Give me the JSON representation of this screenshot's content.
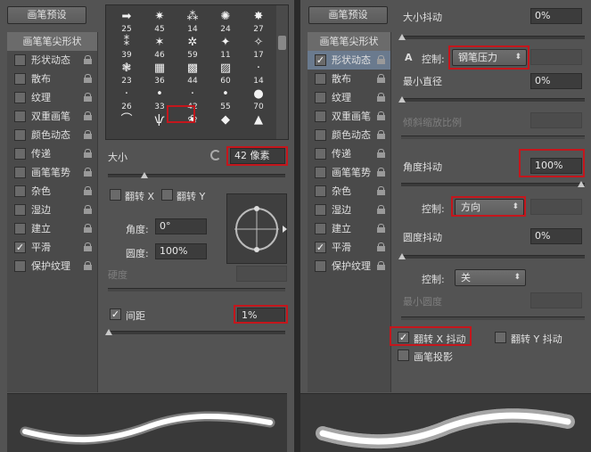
{
  "left": {
    "preset_button": "画笔预设",
    "list": [
      {
        "label": "画笔笔尖形状",
        "checked": false,
        "type": "head"
      },
      {
        "label": "形状动态",
        "checked": false,
        "lock": true
      },
      {
        "label": "散布",
        "checked": false,
        "lock": true
      },
      {
        "label": "纹理",
        "checked": false,
        "lock": true
      },
      {
        "label": "双重画笔",
        "checked": false,
        "lock": true
      },
      {
        "label": "颜色动态",
        "checked": false,
        "lock": true
      },
      {
        "label": "传递",
        "checked": false,
        "lock": true
      },
      {
        "label": "画笔笔势",
        "checked": false,
        "lock": true
      },
      {
        "label": "杂色",
        "checked": false,
        "lock": true
      },
      {
        "label": "湿边",
        "checked": false,
        "lock": true
      },
      {
        "label": "建立",
        "checked": false,
        "lock": true
      },
      {
        "label": "平滑",
        "checked": true,
        "lock": true
      },
      {
        "label": "保护纹理",
        "checked": false,
        "lock": true
      }
    ],
    "tips": [
      {
        "glyph": "➡",
        "size": "25"
      },
      {
        "glyph": "✷",
        "size": "45"
      },
      {
        "glyph": "⁂",
        "size": "14"
      },
      {
        "glyph": "✺",
        "size": "24"
      },
      {
        "glyph": "✸",
        "size": "27"
      },
      {
        "glyph": "⁑",
        "size": "39"
      },
      {
        "glyph": "✶",
        "size": "46"
      },
      {
        "glyph": "✲",
        "size": "59"
      },
      {
        "glyph": "✦",
        "size": "11"
      },
      {
        "glyph": "✧",
        "size": "17"
      },
      {
        "glyph": "❃",
        "size": "23"
      },
      {
        "glyph": "▦",
        "size": "36"
      },
      {
        "glyph": "▩",
        "size": "44"
      },
      {
        "glyph": "▨",
        "size": "60"
      },
      {
        "glyph": "·",
        "size": "14"
      },
      {
        "glyph": "·",
        "size": "26"
      },
      {
        "glyph": "•",
        "size": "33"
      },
      {
        "glyph": "·",
        "size": "42"
      },
      {
        "glyph": "•",
        "size": "55"
      },
      {
        "glyph": "●",
        "size": "70"
      },
      {
        "glyph": "⌒",
        "size": ""
      },
      {
        "glyph": "ѱ",
        "size": ""
      },
      {
        "glyph": "❀",
        "size": ""
      },
      {
        "glyph": "◆",
        "size": ""
      },
      {
        "glyph": "▲",
        "size": ""
      }
    ],
    "size_label": "大小",
    "size_value": "42 像素",
    "flip_x": "翻转 X",
    "flip_y": "翻转 Y",
    "angle_label": "角度:",
    "angle_value": "0°",
    "roundness_label": "圆度:",
    "roundness_value": "100%",
    "hardness_label": "硬度",
    "spacing_label": "间距",
    "spacing_checked": true,
    "spacing_value": "1%"
  },
  "right": {
    "preset_button": "画笔预设",
    "list": [
      {
        "label": "画笔笔尖形状",
        "checked": false,
        "type": "head"
      },
      {
        "label": "形状动态",
        "checked": true,
        "lock": true,
        "selected": true
      },
      {
        "label": "散布",
        "checked": false,
        "lock": true
      },
      {
        "label": "纹理",
        "checked": false,
        "lock": true
      },
      {
        "label": "双重画笔",
        "checked": false,
        "lock": true
      },
      {
        "label": "颜色动态",
        "checked": false,
        "lock": true
      },
      {
        "label": "传递",
        "checked": false,
        "lock": true
      },
      {
        "label": "画笔笔势",
        "checked": false,
        "lock": true
      },
      {
        "label": "杂色",
        "checked": false,
        "lock": true
      },
      {
        "label": "湿边",
        "checked": false,
        "lock": true
      },
      {
        "label": "建立",
        "checked": false,
        "lock": true
      },
      {
        "label": "平滑",
        "checked": true,
        "lock": true
      },
      {
        "label": "保护纹理",
        "checked": false,
        "lock": true
      }
    ],
    "size_jitter_label": "大小抖动",
    "size_jitter_value": "0%",
    "control_label": "控制:",
    "control_warning": "A",
    "control_value": "钢笔压力",
    "min_diameter_label": "最小直径",
    "min_diameter_value": "0%",
    "tilt_scale_label": "倾斜缩放比例",
    "angle_jitter_label": "角度抖动",
    "angle_jitter_value": "100%",
    "angle_control_label": "控制:",
    "angle_control_value": "方向",
    "roundness_jitter_label": "圆度抖动",
    "roundness_jitter_value": "0%",
    "roundness_control_label": "控制:",
    "roundness_control_value": "关",
    "min_roundness_label": "最小圆度",
    "flip_x_jitter": "翻转 X 抖动",
    "flip_x_checked": true,
    "flip_y_jitter": "翻转 Y 抖动",
    "flip_y_checked": false,
    "brush_projection": "画笔投影",
    "brush_projection_checked": false
  },
  "colors": {
    "panel": "#535353",
    "highlight": "#c4161c",
    "selected_row": "#6a7a8e"
  }
}
